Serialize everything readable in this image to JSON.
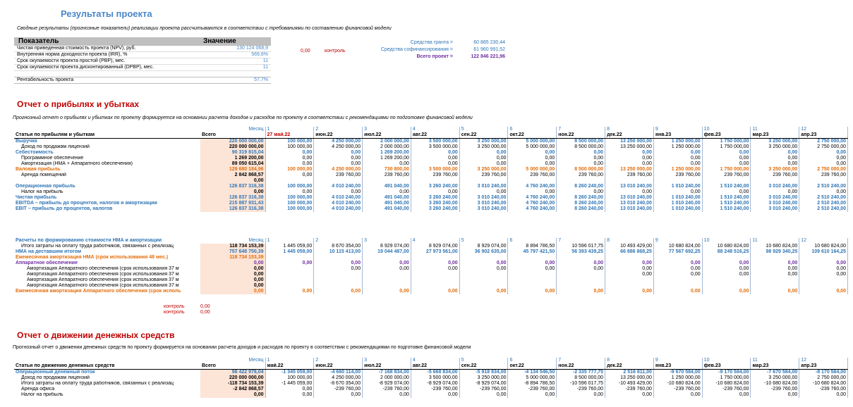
{
  "title": "Результаты проекта",
  "intro": "Сводные результаты (прогнозные показатели) реализации проекта рассчитываются в соответствии с требованиями по составлению финансовой модели",
  "summary": {
    "col_indicator": "Показатель",
    "col_value": "Значение",
    "rows": [
      {
        "label": "Чистая приведенная стоимость проекта (NPV), руб.",
        "value": "130 124 068,9"
      },
      {
        "label": "Внутренняя норма доходности проекта (IRR), %",
        "value": "569,8%"
      },
      {
        "label": "Срок окупаемости проекта простой (PBP), мес.",
        "value": "11"
      },
      {
        "label": "Срок окупаемости проекта дисконтированный (DPBP), мес.",
        "value": "11"
      }
    ],
    "profitability_label": "Рентабельность проекта",
    "profitability_value": "57,7%",
    "control_value": "0,00",
    "control_label": "контроль"
  },
  "funding": [
    {
      "label": "Средства гранта =",
      "value": "60 885 230,44"
    },
    {
      "label": "Средства софинансирования =",
      "value": "61 960 991,52"
    },
    {
      "label": "Всего проект =",
      "value": "122 846 221,96"
    }
  ],
  "pl": {
    "title": "Отчет о прибылях и убытках",
    "note": "Прогнозный отчет о прибылях и убытках по проекту формируется на основании расчета доходов и расходов по проекту в соответствии с рекомендациями по подготовке финансовой модели",
    "month_label": "Месяц",
    "month_nums": [
      "1",
      "2",
      "3",
      "4",
      "5",
      "6",
      "7",
      "8",
      "9",
      "10",
      "11",
      "12"
    ],
    "header_label": "Статьи по прибылям и убыткам",
    "total_label": "Всего",
    "months": [
      "27 май.22",
      "июн.22",
      "июл.22",
      "авг.22",
      "сен.22",
      "окт.22",
      "ноя.22",
      "дек.22",
      "янв.23",
      "фев.23",
      "мар.23",
      "апр.23"
    ],
    "rows": [
      {
        "label": "Выручка",
        "style": "blue",
        "indent": 0,
        "total": "220 000 000,00",
        "v": [
          "100 000,00",
          "4 250 000,00",
          "2 000 000,00",
          "3 500 000,00",
          "3 250 000,00",
          "5 000 000,00",
          "8 500 000,00",
          "13 250 000,00",
          "1 250 000,00",
          "1 750 000,00",
          "3 250 000,00",
          "2 750 000,00"
        ]
      },
      {
        "label": "Доход по продажам лицензий",
        "style": "",
        "indent": 1,
        "total": "220 000 000,00",
        "v": [
          "100 000,00",
          "4 250 000,00",
          "2 000 000,00",
          "3 500 000,00",
          "3 250 000,00",
          "5 000 000,00",
          "8 500 000,00",
          "13 250 000,00",
          "1 250 000,00",
          "1 750 000,00",
          "3 250 000,00",
          "2 750 000,00"
        ]
      },
      {
        "label": "Себестоимость",
        "style": "blue",
        "indent": 0,
        "total": "90 319 815,04",
        "v": [
          "0,00",
          "0,00",
          "1 269 200,00",
          "0,00",
          "0,00",
          "0,00",
          "0,00",
          "0,00",
          "0,00",
          "0,00",
          "0,00",
          "0,00"
        ]
      },
      {
        "label": "Программное обеспечение",
        "style": "",
        "indent": 1,
        "total": "1 269 200,00",
        "v": [
          "0,00",
          "0,00",
          "1 269 200,00",
          "0,00",
          "0,00",
          "0,00",
          "0,00",
          "0,00",
          "0,00",
          "0,00",
          "0,00",
          "0,00"
        ]
      },
      {
        "label": "Амортизация (НМА + Аппаратного обеспечения)",
        "style": "",
        "indent": 1,
        "total": "89 050 615,04",
        "v": [
          "0,00",
          "0,00",
          "0,00",
          "0,00",
          "0,00",
          "0,00",
          "0,00",
          "0,00",
          "0,00",
          "0,00",
          "0,00",
          "0,00"
        ]
      },
      {
        "label": "Валовая прибыль",
        "style": "orange",
        "indent": 0,
        "total": "129 680 184,96",
        "v": [
          "100 000,00",
          "4 250 000,00",
          "730 800,00",
          "3 500 000,00",
          "3 250 000,00",
          "5 000 000,00",
          "8 500 000,00",
          "13 250 000,00",
          "1 250 000,00",
          "1 750 000,00",
          "3 250 000,00",
          "2 750 000,00"
        ]
      },
      {
        "label": "Аренда помещений",
        "style": "",
        "indent": 1,
        "total": "2 842 868,57",
        "v": [
          "0,00",
          "239 760,00",
          "239 760,00",
          "239 760,00",
          "239 760,00",
          "239 760,00",
          "239 760,00",
          "239 760,00",
          "239 760,00",
          "239 760,00",
          "239 760,00",
          "239 760,00"
        ]
      },
      {
        "label": "",
        "style": "",
        "indent": 0,
        "total": "0,00",
        "v": [
          "",
          "",
          "",
          "",
          "",
          "",
          "",
          "",
          "",
          "",
          "",
          ""
        ]
      },
      {
        "label": "Операционная прибыль",
        "style": "blue",
        "indent": 0,
        "total": "126 837 316,38",
        "v": [
          "100 000,00",
          "4 010 240,00",
          "491 040,00",
          "3 260 240,00",
          "3 010 240,00",
          "4 760 240,00",
          "8 260 240,00",
          "13 010 240,00",
          "1 010 240,00",
          "1 510 240,00",
          "3 010 240,00",
          "2 510 240,00"
        ]
      },
      {
        "label": "Налог на прибыль",
        "style": "",
        "indent": 1,
        "total": "0,00",
        "v": [
          "0,00",
          "0,00",
          "0,00",
          "0,00",
          "0,00",
          "0,00",
          "0,00",
          "0,00",
          "0,00",
          "0,00",
          "0,00",
          "0,00"
        ]
      },
      {
        "label": "Чистая прибыль",
        "style": "blue",
        "indent": 0,
        "total": "126 837 316,38",
        "v": [
          "100 000,00",
          "4 010 240,00",
          "491 040,00",
          "3 260 240,00",
          "3 010 240,00",
          "4 760 240,00",
          "8 260 240,00",
          "13 010 240,00",
          "1 010 240,00",
          "1 510 240,00",
          "3 010 240,00",
          "2 510 240,00"
        ]
      },
      {
        "label": "EBITDA – прибыль до процентов, налогов и амортизации",
        "style": "blue",
        "indent": 0,
        "total": "215 887 931,43",
        "v": [
          "100 000,00",
          "4 010 240,00",
          "491 040,00",
          "3 260 240,00",
          "3 010 240,00",
          "4 760 240,00",
          "8 260 240,00",
          "13 010 240,00",
          "1 010 240,00",
          "1 510 240,00",
          "3 010 240,00",
          "2 510 240,00"
        ]
      },
      {
        "label": "EBIT – прибыль до процентов, налогов",
        "style": "blue",
        "indent": 0,
        "total": "126 837 316,38",
        "v": [
          "100 000,00",
          "4 010 240,00",
          "491 040,00",
          "3 260 240,00",
          "3 010 240,00",
          "4 760 240,00",
          "8 260 240,00",
          "13 010 240,00",
          "1 010 240,00",
          "1 510 240,00",
          "3 010 240,00",
          "2 510 240,00"
        ]
      }
    ]
  },
  "amort": {
    "header_label": "Расчеты по формированию стоимости НМА и амортизации",
    "month_label": "Месяц",
    "month_nums": [
      "1",
      "2",
      "3",
      "4",
      "5",
      "6",
      "7",
      "8",
      "9",
      "10",
      "11",
      "12"
    ],
    "rows": [
      {
        "label": "Итого затраты на оплату труда работников, связанных с реализац",
        "style": "",
        "indent": 1,
        "total": "118 734 153,39",
        "v": [
          "1 445 059,00",
          "8 670 354,00",
          "8 929 074,00",
          "8 929 074,00",
          "8 929 074,00",
          "8 894 786,50",
          "10 596 017,75",
          "10 493 429,00",
          "10 680 824,00",
          "10 680 824,00",
          "10 680 824,00",
          "10 680 824,00"
        ]
      },
      {
        "label": "НМА на деставшим итогом",
        "style": "blue",
        "indent": 0,
        "total": "757 648 750,39",
        "v": [
          "1 445 059,00",
          "10 115 413,00",
          "19 044 487,00",
          "27 973 561,00",
          "36 902 635,00",
          "45 797 421,50",
          "56 393 439,25",
          "66 886 868,25",
          "77 567 692,25",
          "88 248 516,25",
          "98 929 340,25",
          "109 610 164,25"
        ]
      },
      {
        "label": "Ежемесячная амортизация НМА (срок использования 48 мес.)",
        "style": "orange",
        "indent": 0,
        "total": "118 734 153,39",
        "v": [
          "",
          "",
          "",
          "",
          "",
          "",
          "",
          "",
          "",
          "",
          "",
          ""
        ]
      },
      {
        "label": "Аппаратное обеспечение",
        "style": "purple",
        "indent": 0,
        "total": "0,00",
        "v": [
          "0,00",
          "0,00",
          "0,00",
          "0,00",
          "0,00",
          "0,00",
          "0,00",
          "0,00",
          "0,00",
          "0,00",
          "0,00",
          "0,00"
        ]
      },
      {
        "label": "Амортизация Аппаратного обеспечения (срок использования 37 м",
        "style": "",
        "indent": 2,
        "total": "0,00",
        "v": [
          "",
          "0,00",
          "0,00",
          "0,00",
          "0,00",
          "0,00",
          "0,00",
          "0,00",
          "0,00",
          "0,00",
          "0,00",
          "0,00"
        ]
      },
      {
        "label": "Амортизация Аппаратного обеспечения (срок использования 37 м",
        "style": "",
        "indent": 2,
        "total": "0,00",
        "v": [
          "",
          "",
          "",
          "",
          "",
          "",
          "",
          "0,00",
          "0,00",
          "0,00",
          "0,00",
          "0,00"
        ]
      },
      {
        "label": "Амортизация Аппаратного обеспечения (срок использования 37 м",
        "style": "",
        "indent": 2,
        "total": "0,00",
        "v": [
          "",
          "",
          "",
          "",
          "",
          "",
          "",
          "",
          "",
          "",
          "",
          ""
        ]
      },
      {
        "label": "Амортизация Аппаратного обеспечения (срок использования 37 м",
        "style": "",
        "indent": 2,
        "total": "0,00",
        "v": [
          "",
          "",
          "",
          "",
          "",
          "",
          "",
          "",
          "",
          "",
          "",
          ""
        ]
      },
      {
        "label": "Ежемесячная амортизация Аппаратного обеспечения (срок исполь",
        "style": "orange",
        "indent": 0,
        "total": "0,00",
        "v": [
          "0,00",
          "0,00",
          "0,00",
          "0,00",
          "0,00",
          "0,00",
          "0,00",
          "0,00",
          "0,00",
          "0,00",
          "0,00",
          "0,00"
        ]
      }
    ],
    "control": [
      {
        "label": "контроль",
        "value": "0,00"
      },
      {
        "label": "контроль",
        "value": "0,00"
      }
    ]
  },
  "cf": {
    "title": "Отчет о движении денежных средств",
    "note": "Прогнозный отчет о движении денежных средств по проекту формируется на основании расчета доходов и расходов по проекту в соответствии с рекомендациями по подготовке финансовой модели",
    "month_label": "Месяц",
    "month_nums": [
      "1",
      "2",
      "3",
      "4",
      "5",
      "6",
      "7",
      "8",
      "9",
      "10",
      "11",
      "12"
    ],
    "header_label": "Статьи по движению денежных средств",
    "total_label": "Всего",
    "months": [
      "май.22",
      "июн.22",
      "июл.22",
      "авг.22",
      "сен.22",
      "окт.22",
      "ноя.22",
      "дек.22",
      "янв.23",
      "фев.23",
      "мар.23",
      "апр.23"
    ],
    "rows": [
      {
        "label": "Операционный денежный поток",
        "style": "blue",
        "indent": 0,
        "total": "98 422 978,04",
        "v": [
          "-1 345 059,00",
          "-4 660 114,00",
          "-7 168 834,00",
          "-5 668 834,00",
          "-5 918 834,00",
          "-4 134 546,50",
          "-2 335 777,75",
          "2 516 811,00",
          "-9 670 584,00",
          "-9 170 584,00",
          "-7 670 584,00",
          "-8 170 584,00"
        ]
      },
      {
        "label": "Доход по продажам лицензий",
        "style": "",
        "indent": 1,
        "total": "220 000 000,00",
        "v": [
          "100 000,00",
          "4 250 000,00",
          "2 000 000,00",
          "3 500 000,00",
          "3 250 000,00",
          "5 000 000,00",
          "8 500 000,00",
          "13 250 000,00",
          "1 250 000,00",
          "1 750 000,00",
          "3 250 000,00",
          "2 750 000,00"
        ]
      },
      {
        "label": "Итого затраты на оплату труда работников, связанных с реализац",
        "style": "",
        "indent": 1,
        "total": "-118 734 153,39",
        "v": [
          "-1 445 059,00",
          "-8 670 354,00",
          "-8 929 074,00",
          "-8 929 074,00",
          "-8 929 074,00",
          "-8 894 786,50",
          "-10 596 017,75",
          "-10 493 429,00",
          "-10 680 824,00",
          "-10 680 824,00",
          "-10 680 824,00",
          "-10 680 824,00"
        ]
      },
      {
        "label": "Аренда офиса",
        "style": "",
        "indent": 1,
        "total": "-2 842 868,57",
        "v": [
          "0,00",
          "-239 760,00",
          "-239 760,00",
          "-239 760,00",
          "-239 760,00",
          "-239 760,00",
          "-239 760,00",
          "-239 760,00",
          "-239 760,00",
          "-239 760,00",
          "-239 760,00",
          "-239 760,00"
        ]
      },
      {
        "label": "Налог на прибыль",
        "style": "",
        "indent": 1,
        "total": "0,00",
        "v": [
          "0,00",
          "0,00",
          "0,00",
          "0,00",
          "0,00",
          "0,00",
          "0,00",
          "0,00",
          "0,00",
          "0,00",
          "0,00",
          "0,00"
        ]
      }
    ]
  }
}
